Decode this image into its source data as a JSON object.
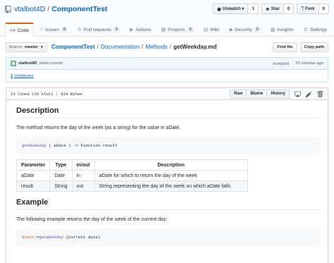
{
  "repo": {
    "owner": "vtalbot4D",
    "name": "ComponentTest"
  },
  "header_actions": [
    {
      "icon": "eye-icon",
      "label": "Unwatch ▾",
      "count": "1"
    },
    {
      "icon": "star-icon",
      "label": "Star",
      "count": "0"
    },
    {
      "icon": "fork-icon",
      "label": "Fork",
      "count": "0"
    }
  ],
  "tabs": [
    {
      "icon": "code-icon",
      "label": "Code",
      "count": null,
      "selected": true
    },
    {
      "icon": "issue-icon",
      "label": "Issues",
      "count": "0"
    },
    {
      "icon": "pull-request-icon",
      "label": "Pull requests",
      "count": "0"
    },
    {
      "icon": "play-icon",
      "label": "Actions",
      "count": null
    },
    {
      "icon": "project-icon",
      "label": "Projects",
      "count": "0"
    },
    {
      "icon": "book-icon",
      "label": "Wiki",
      "count": null
    },
    {
      "icon": "shield-icon",
      "label": "Security",
      "count": "0"
    },
    {
      "icon": "graph-icon",
      "label": "Insights",
      "count": null
    },
    {
      "icon": "gear-icon",
      "label": "Settings",
      "count": null
    }
  ],
  "branch": {
    "prefix": "Branch:",
    "name": "master"
  },
  "breadcrumb": {
    "root": "ComponentTest",
    "parts": [
      "Documentation",
      "Methods"
    ],
    "file": "getWeekday.md"
  },
  "nav_buttons": {
    "find_file": "Find file",
    "copy_path": "Copy path"
  },
  "commit": {
    "author": "vtalbot4D",
    "message": "initial commit",
    "sha": "4348899",
    "ago": "31 minutes ago"
  },
  "contributors": {
    "count": "1",
    "label": "contributor"
  },
  "file": {
    "lines": "23 lines (16 sloc)",
    "size": "614 Bytes",
    "buttons": {
      "raw": "Raw",
      "blame": "Blame",
      "history": "History"
    }
  },
  "doc": {
    "h_description": "Description",
    "p_description": "The method returns the day of the week (as a string) for the value in aDate.",
    "signature": {
      "fn": "getWeekday",
      "rest": " ( aDate ) -> Function result"
    },
    "table": {
      "headers": [
        "Parameter",
        "Type",
        "in/out",
        "Description"
      ],
      "rows": [
        [
          "aDate",
          "Date",
          "in",
          "aDate for which to return the day of the week"
        ],
        [
          "result",
          "String",
          "out",
          "String representing the day of the week on which aDate falls."
        ]
      ]
    },
    "h_example": "Example",
    "p_example": "The following example returns the day of the week of the current day:",
    "example_code": {
      "var": "$text",
      "op": ":=",
      "fn": "getWeekday",
      "rest": " (Current date)"
    }
  },
  "colors": {
    "link": "#0366d6",
    "selected_tab_accent": "#e36209",
    "commit_bg": "#f1f8ff"
  }
}
